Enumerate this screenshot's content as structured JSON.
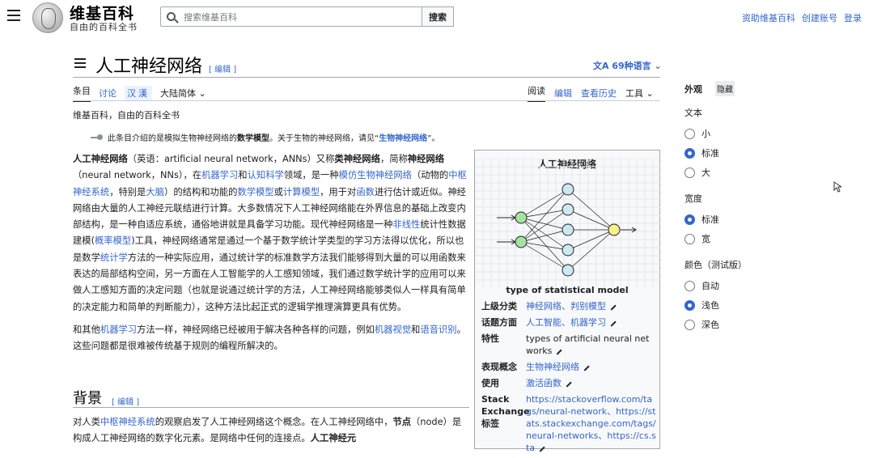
{
  "header": {
    "logo_title": "维基百科",
    "logo_subtitle": "自由的百科全书",
    "search_placeholder": "搜索维基百科",
    "search_button": "搜索",
    "links": [
      "资助维基百科",
      "创建账号",
      "登录"
    ]
  },
  "page": {
    "title": "人工神经网络",
    "edit_label": "[ 编辑 ]",
    "languages": "69种语言",
    "tabs_left": [
      "条目",
      "讨论"
    ],
    "variant": "汉漢",
    "variant_dropdown": "大陆简体",
    "tabs_right": [
      "阅读",
      "编辑",
      "查看历史",
      "工具"
    ],
    "site_subtitle": "维基百科，自由的百科全书",
    "hatnote": {
      "prefix": "此条目介绍的是模拟生物神经网络的",
      "bold": "数学模型",
      "middle": "。关于生物的神经网络，请见“",
      "link": "生物神经网络",
      "suffix": "”。"
    }
  },
  "article": {
    "p1": [
      {
        "t": "人工神经网络",
        "b": true
      },
      {
        "t": "（英语：artificial neural network，ANNs）又称"
      },
      {
        "t": "类神经网络",
        "b": true
      },
      {
        "t": "，简称"
      },
      {
        "t": "神经网络",
        "b": true
      },
      {
        "t": "（neural network，NNs），在"
      },
      {
        "t": "机器学习",
        "l": true
      },
      {
        "t": "和"
      },
      {
        "t": "认知科学",
        "l": true
      },
      {
        "t": "领域，是一种"
      },
      {
        "t": "模仿生物神经网络",
        "l": true
      },
      {
        "t": "（动物的"
      },
      {
        "t": "中枢神经系统",
        "l": true
      },
      {
        "t": "，特别是"
      },
      {
        "t": "大脑",
        "l": true
      },
      {
        "t": "）的结构和功能的"
      },
      {
        "t": "数学模型",
        "l": true
      },
      {
        "t": "或"
      },
      {
        "t": "计算模型",
        "l": true
      },
      {
        "t": "，用于对"
      },
      {
        "t": "函数",
        "l": true
      },
      {
        "t": "进行估计或近似。神经网络由大量的人工神经元联结进行计算。大多数情况下人工神经网络能在外界信息的基础上改变内部结构，是一种自适应系统，通俗地讲就是具备学习功能。现代神经网络是一种"
      },
      {
        "t": "非线性",
        "l": true
      },
      {
        "t": "统计性数据建模("
      },
      {
        "t": "概率模型",
        "l": true
      },
      {
        "t": ")工具，神经网络通常是通过一个基于数学统计学类型的学习方法得以优化，所以也是数学"
      },
      {
        "t": "统计学",
        "l": true
      },
      {
        "t": "方法的一种实际应用，通过统计学的标准数学方法我们能够得到大量的可以用函数来表达的局部结构空间，另一方面在人工智能学的人工感知领域，我们通过数学统计学的应用可以来做人工感知方面的决定问题（也就是说通过统计学的方法，人工神经网络能够类似人一样具有简单的决定能力和简单的判断能力），这种方法比起正式的逻辑学推理演算更具有优势。"
      }
    ],
    "p2": [
      {
        "t": "和其他"
      },
      {
        "t": "机器学习",
        "l": true
      },
      {
        "t": "方法一样，神经网络已经被用于解决各种各样的问题，例如"
      },
      {
        "t": "机器视觉",
        "l": true
      },
      {
        "t": "和"
      },
      {
        "t": "语音识别",
        "l": true
      },
      {
        "t": "。这些问题都是很难被传统基于规则的编程所解决的。"
      }
    ],
    "section_title": "背景",
    "p3": [
      {
        "t": "对人类"
      },
      {
        "t": "中枢神经系统",
        "l": true
      },
      {
        "t": "的观察启发了人工神经网络这个概念。在人工神经网络中，"
      },
      {
        "t": "节点",
        "b": true
      },
      {
        "t": "（node）是构成人工神经网络的数字化元素。是网络中任何的连接点。"
      },
      {
        "t": "人工神经元",
        "b": true
      }
    ]
  },
  "infobox": {
    "title": "人工神经网络",
    "caption": "type of statistical model",
    "rows": [
      {
        "label": "上级分类",
        "value": "神经网络、判别模型",
        "link": true
      },
      {
        "label": "话题方面",
        "value": "人工智能、机器学习",
        "link": true
      },
      {
        "label": "特性",
        "value": "types of artificial neural networks",
        "link": false
      },
      {
        "label": "表现概念",
        "value": "生物神经网络",
        "link": true
      },
      {
        "label": "使用",
        "value": "激活函数",
        "link": true
      },
      {
        "label": "Stack Exchange 标签",
        "value": "https://stackoverflow.com/tags/neural-network、https://stats.stackexchange.com/tags/neural-networks、https://cs.sta",
        "link": true
      }
    ]
  },
  "panel": {
    "title": "外观",
    "hide": "隐藏",
    "sections": [
      {
        "name": "文本",
        "options": [
          "小",
          "标准",
          "大"
        ],
        "selected": 1
      },
      {
        "name": "宽度",
        "options": [
          "标准",
          "宽"
        ],
        "selected": 0
      },
      {
        "name": "颜色（测试版）",
        "options": [
          "自动",
          "浅色",
          "深色"
        ],
        "selected": 1
      }
    ]
  },
  "colors": {
    "link": "#3366cc",
    "text": "#202122",
    "neuron_fill": "#cce9f2",
    "output_fill": "#f5f28a"
  }
}
